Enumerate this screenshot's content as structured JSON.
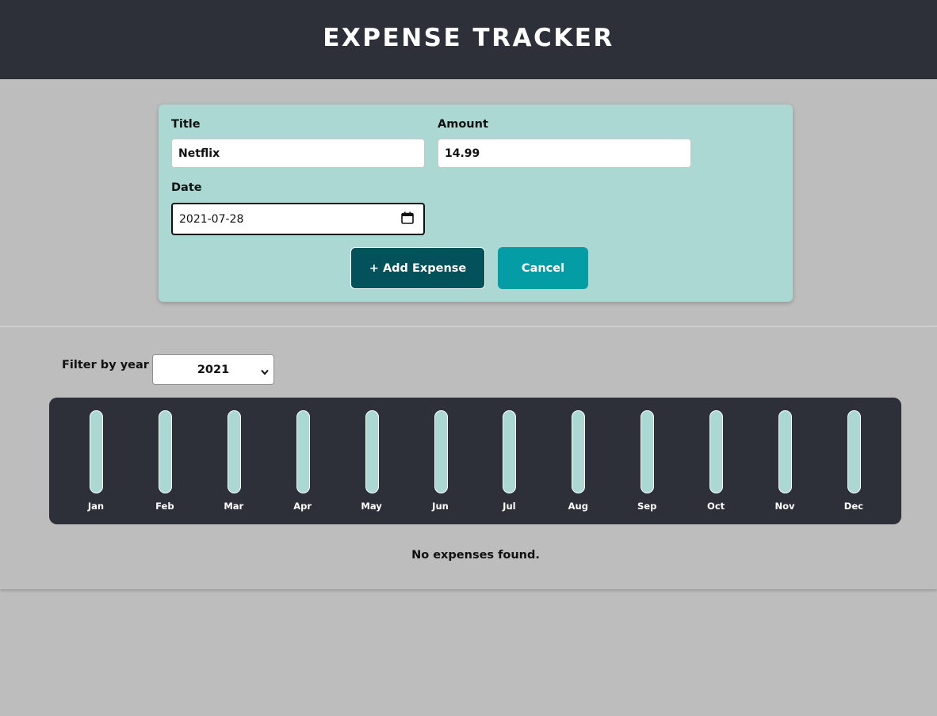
{
  "header": {
    "title": "EXPENSE TRACKER"
  },
  "form": {
    "title_label": "Title",
    "title_value": "Netflix",
    "amount_label": "Amount",
    "amount_value": "14.99",
    "date_label": "Date",
    "date_value": "2021-07-28",
    "add_button": "+ Add Expense",
    "cancel_button": "Cancel"
  },
  "filter": {
    "label": "Filter by year",
    "selected_year": "2021"
  },
  "chart_data": {
    "type": "bar",
    "categories": [
      "Jan",
      "Feb",
      "Mar",
      "Apr",
      "May",
      "Jun",
      "Jul",
      "Aug",
      "Sep",
      "Oct",
      "Nov",
      "Dec"
    ],
    "values": [
      0,
      0,
      0,
      0,
      0,
      0,
      0,
      0,
      0,
      0,
      0,
      0
    ]
  },
  "expenses": {
    "empty_message": "No expenses found."
  },
  "colors": {
    "header_bg": "#2d3038",
    "form_bg": "#acd8d4",
    "add_button": "#03515a",
    "cancel_button": "#049da6",
    "bar_empty": "#acd8d4",
    "page_bg": "#bdbdbd"
  }
}
